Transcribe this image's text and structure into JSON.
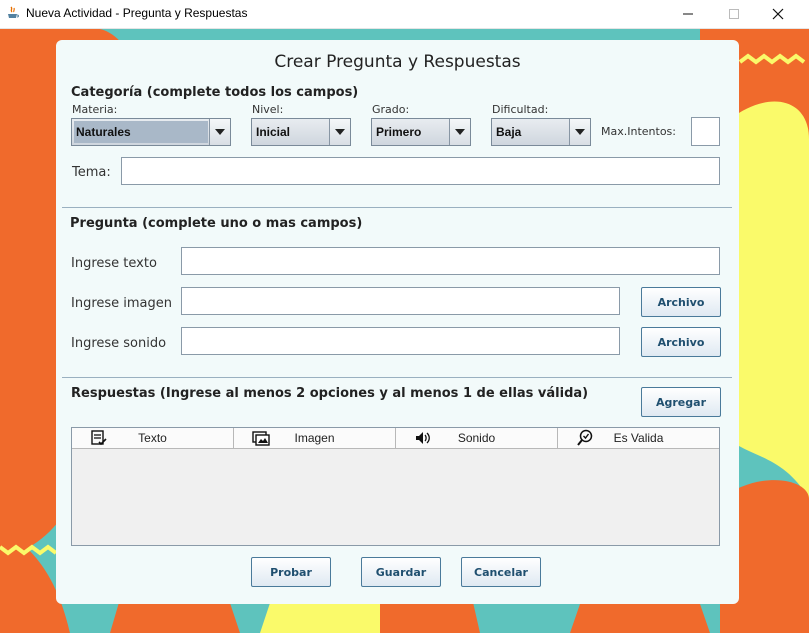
{
  "window": {
    "title": "Nueva Actividad - Pregunta y Respuestas",
    "minimize_glyph": "—",
    "maximize_glyph": "☐",
    "close_glyph": "✕",
    "app_icon": "java-icon"
  },
  "dialog": {
    "title": "Crear Pregunta y Respuestas",
    "category": {
      "heading": "Categoría (complete todos los campos)",
      "materia_label": "Materia:",
      "materia_value": "Naturales",
      "nivel_label": "Nivel:",
      "nivel_value": "Inicial",
      "grado_label": "Grado:",
      "grado_value": "Primero",
      "dificultad_label": "Dificultad:",
      "dificultad_value": "Baja",
      "max_intentos_label": "Max.Intentos:",
      "max_intentos_value": "",
      "tema_label": "Tema:",
      "tema_value": ""
    },
    "question": {
      "heading": "Pregunta (complete uno o mas campos)",
      "text_label": "Ingrese texto",
      "text_value": "",
      "image_label": "Ingrese imagen",
      "image_value": "",
      "image_button": "Archivo",
      "sound_label": "Ingrese sonido",
      "sound_value": "",
      "sound_button": "Archivo"
    },
    "answers": {
      "heading": "Respuestas (Ingrese al menos 2 opciones y al menos 1 de ellas válida)",
      "add_button": "Agregar",
      "columns": [
        {
          "label": "Texto",
          "icon": "text-check-icon"
        },
        {
          "label": "Imagen",
          "icon": "image-icon"
        },
        {
          "label": "Sonido",
          "icon": "speaker-icon"
        },
        {
          "label": "Es Valida",
          "icon": "search-check-icon"
        }
      ],
      "rows": []
    },
    "footer": {
      "probar": "Probar",
      "guardar": "Guardar",
      "cancelar": "Cancelar"
    }
  },
  "colors": {
    "background_teal": "#5ec3bd",
    "background_orange": "#f06a2c",
    "background_yellow": "#fafa6a",
    "panel": "#f2fafa",
    "button_text": "#1f4f6f"
  }
}
